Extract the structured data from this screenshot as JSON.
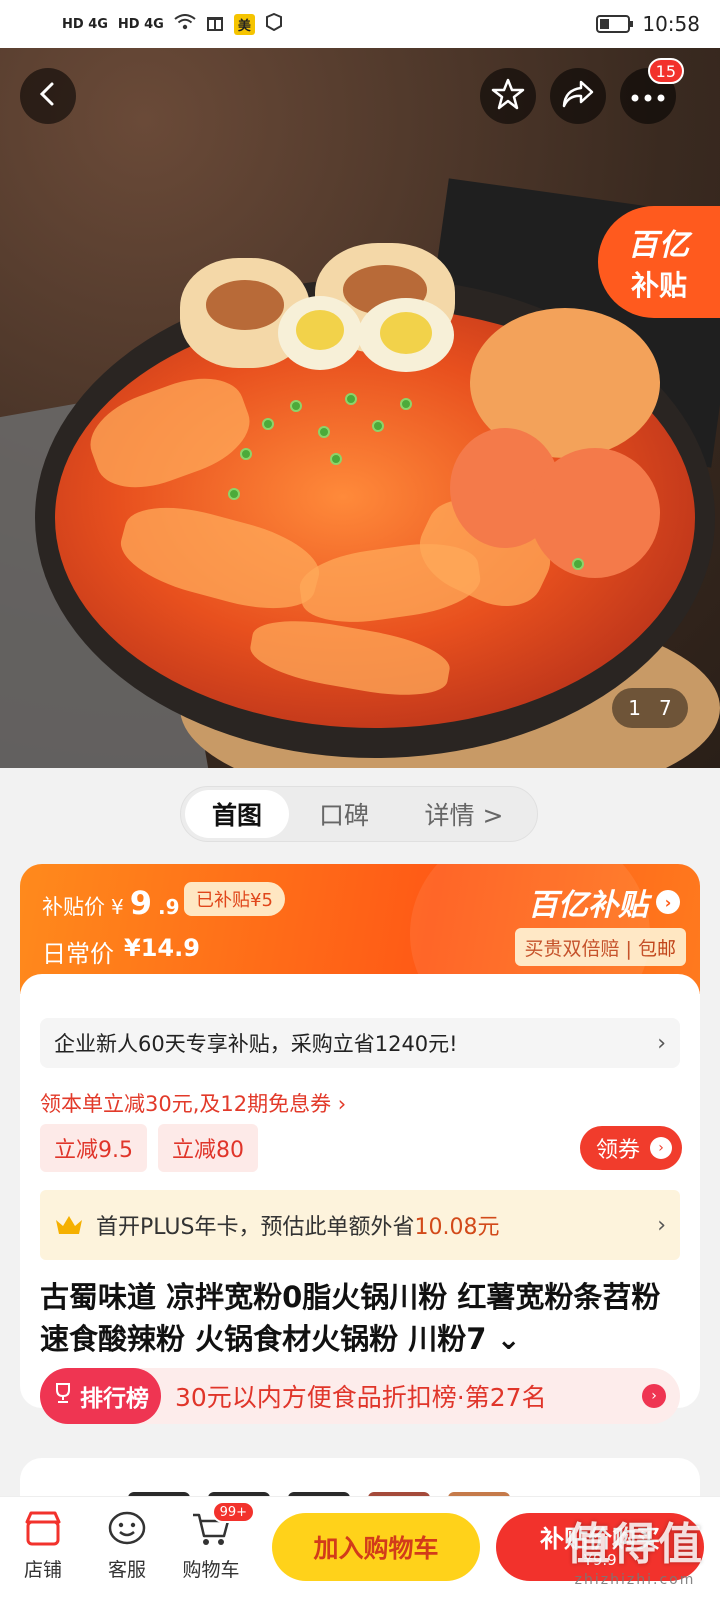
{
  "status_bar": {
    "network_1": "HD 4G",
    "network_2": "HD 4G",
    "app_badge": "美",
    "time": "10:58"
  },
  "hero": {
    "notification_count": "15",
    "yi_badge_line1": "百亿",
    "yi_badge_line2": "补贴",
    "page_current": "1",
    "page_total": "7"
  },
  "tabs": [
    {
      "label": "首图"
    },
    {
      "label": "口碑"
    },
    {
      "label": "详情 >"
    }
  ],
  "price": {
    "subsidy_label": "补贴价",
    "currency": "¥",
    "subsidy_int": "9",
    "subsidy_dec": ".9",
    "saved_chip": "已补贴¥5",
    "daily_label": "日常价",
    "daily_value": "¥14.9",
    "program_title": "百亿补贴",
    "program_sub": "买贵双倍赔 | 包邮"
  },
  "promos": {
    "enterprise": "企业新人60天专享补贴，采购立省1240元!",
    "coupon_line": "领本单立减30元,及12期免息券 ›",
    "chip_1": "立减9.5",
    "chip_2": "立减80",
    "get_coupon": "领券",
    "plus_prefix": "首开PLUS年卡，预估此单额外省",
    "plus_amount": "10.08元"
  },
  "product": {
    "title": "古蜀味道 凉拌宽粉0脂火锅川粉 红薯宽粉条苕粉速食酸辣粉 火锅食材火锅粉 川粉7 ⌄",
    "rank_tag": "排行榜",
    "rank_text": "30元以内方便食品折扣榜·第27名"
  },
  "bottom_bar": {
    "store": "店铺",
    "service": "客服",
    "cart": "购物车",
    "cart_badge": "99+",
    "add_to_cart": "加入购物车",
    "buy_line1": "补贴价购买",
    "buy_line2": "¥9.9"
  },
  "watermark": {
    "big": "值得值",
    "small": "zhizhizhi.com"
  },
  "colors": {
    "accent_red": "#f2322c",
    "accent_orange": "#ff5a16",
    "cart_yellow": "#ffd21a"
  }
}
